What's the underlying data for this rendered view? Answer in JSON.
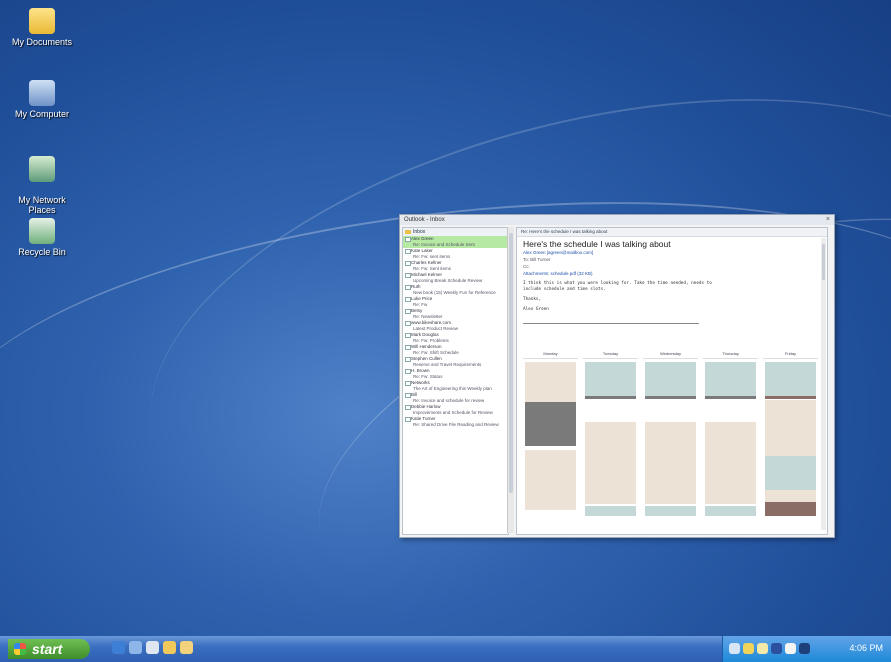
{
  "desktop": {
    "icons": [
      {
        "label": "My Documents",
        "icon": "my-documents-icon"
      },
      {
        "label": "My Computer",
        "icon": "my-computer-icon"
      },
      {
        "label": "My Network\nPlaces",
        "icon": "network-places-icon"
      },
      {
        "label": "Recycle Bin",
        "icon": "recycle-bin-icon"
      }
    ]
  },
  "window": {
    "title": "Outlook - Inbox",
    "folder": "Inbox",
    "messages": [
      {
        "from": "Alex Green",
        "subject": "Re: Invoice and Schedule Sent",
        "selected": true
      },
      {
        "from": "Kate Laker",
        "subject": "Re: Fw: sent items"
      },
      {
        "from": "Charles Kellner",
        "subject": "Re: Fw: Sent items"
      },
      {
        "from": "Michael Kelmer",
        "subject": "Upcoming Break Schedule Review"
      },
      {
        "from": "Ruth",
        "subject": "New book (15) Weekly Fun for Reference"
      },
      {
        "from": "Luke Price",
        "subject": "Re: Fw"
      },
      {
        "from": "Betsy",
        "subject": "Re: Newsletter"
      },
      {
        "from": "www.bikeshare.com",
        "subject": "Latest Product Review"
      },
      {
        "from": "Mark Douglas",
        "subject": "Re: Fw: Problems"
      },
      {
        "from": "Will Henderson",
        "subject": "Re: Fw: Shift Schedule"
      },
      {
        "from": "Stephen Cullen",
        "subject": "Reserve and Travel Requirements"
      },
      {
        "from": "H. Brown",
        "subject": "Re: Fw: Status"
      },
      {
        "from": "Networks",
        "subject": "The Art of Engineering this Weekly plan"
      },
      {
        "from": "Bill",
        "subject": "Re: Invoice and schedule for review"
      },
      {
        "from": "Debbie Harlow",
        "subject": "Improvements and Schedule for Review"
      },
      {
        "from": "Katie Turner",
        "subject": "Re: Shared Drive File Reading and Review"
      }
    ],
    "reading": {
      "header_bar": "Re: Here's the schedule I was talking about",
      "subject": "Here's the schedule I was talking about",
      "from": "Alex Green [agreen@mailbox.com]",
      "to": "To: Bill Turner",
      "cc": "Cc:",
      "attachments": "Attachments: schedule.pdf (32 KB)",
      "body_line1": "I think this is what you were looking for. Take the time needed, needs to",
      "body_line2": "include schedule and time slots.",
      "signoff": "Thanks,",
      "signature": "Alex Green",
      "days": [
        "Monday",
        "Tuesday",
        "Wednesday",
        "Thursday",
        "Friday"
      ]
    }
  },
  "taskbar": {
    "start_label": "start",
    "clock": "4:06 PM"
  }
}
